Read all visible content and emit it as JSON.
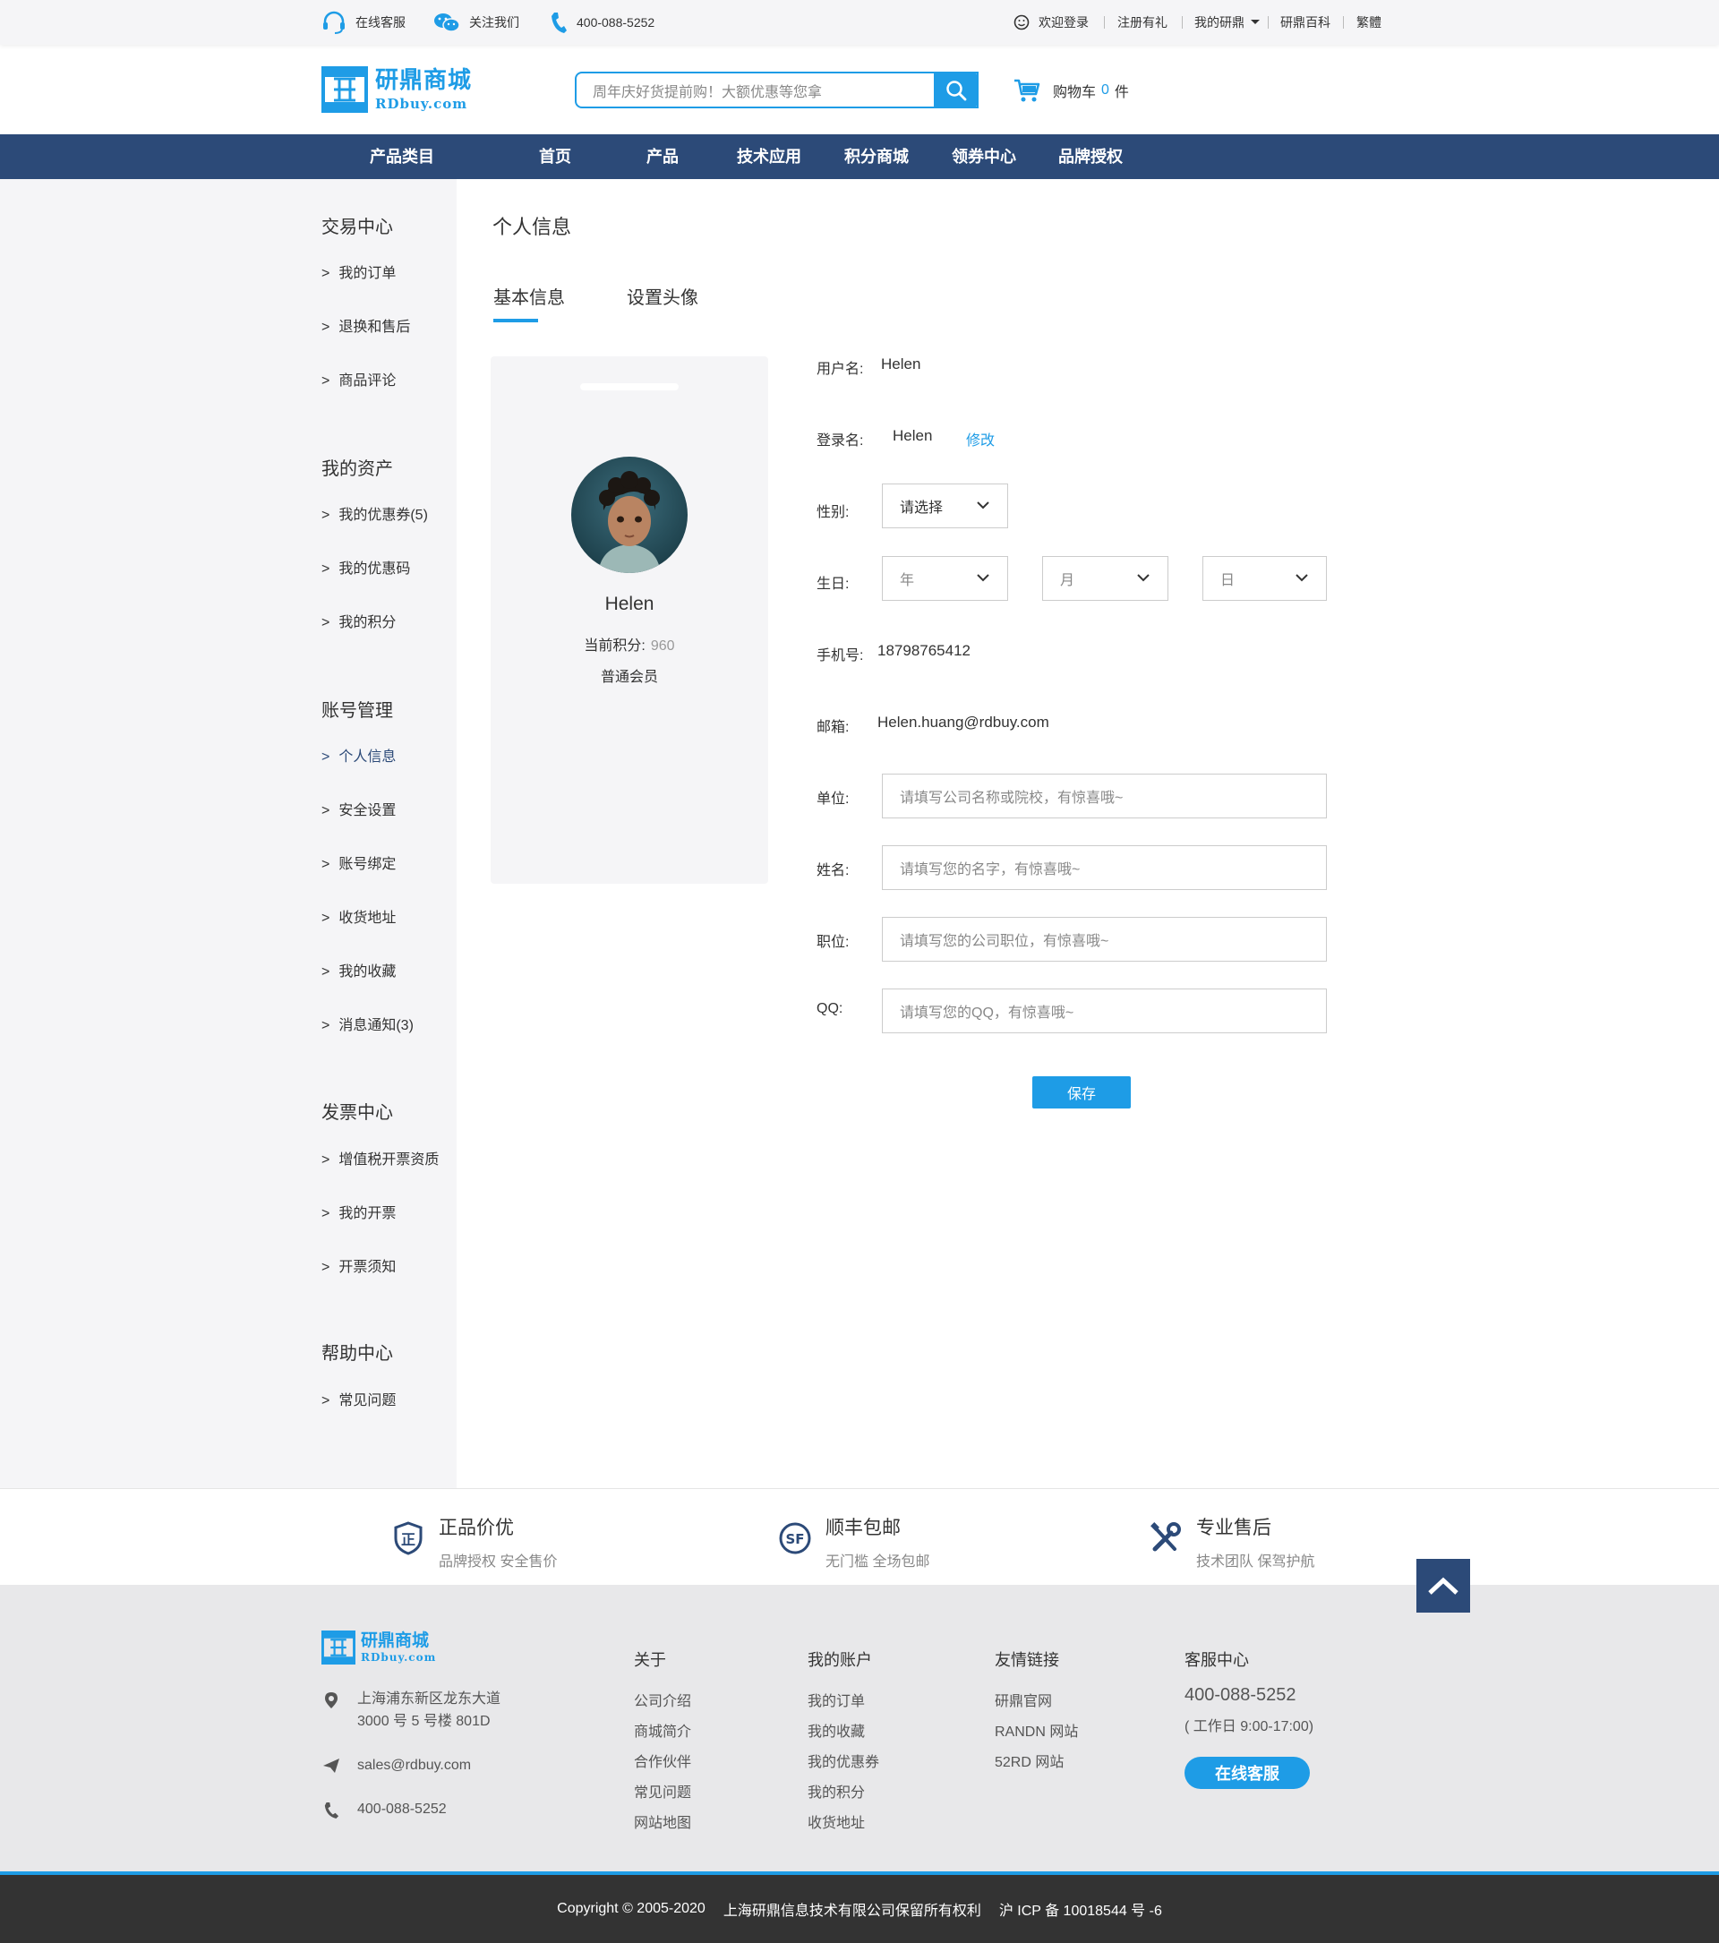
{
  "topbar": {
    "online_service": "在线客服",
    "follow_us": "关注我们",
    "phone": "400-088-5252",
    "welcome": "欢迎登录",
    "register": "注册有礼",
    "my_account": "我的研鼎",
    "wiki": "研鼎百科",
    "traditional": "繁體"
  },
  "header": {
    "logo_cn": "研鼎商城",
    "logo_en": "RDbuy.com",
    "search_placeholder": "周年庆好货提前购！大额优惠等您拿",
    "cart_label": "购物车",
    "cart_count": "0",
    "cart_unit": "件"
  },
  "nav": {
    "items": [
      "产品类目",
      "首页",
      "产品",
      "技术应用",
      "积分商城",
      "领券中心",
      "品牌授权"
    ]
  },
  "sidebar": {
    "sections": [
      {
        "title": "交易中心",
        "items": [
          "我的订单",
          "退换和售后",
          "商品评论"
        ]
      },
      {
        "title": "我的资产",
        "items": [
          "我的优惠券(5)",
          "我的优惠码",
          "我的积分"
        ]
      },
      {
        "title": "账号管理",
        "items": [
          "个人信息",
          "安全设置",
          "账号绑定",
          "收货地址",
          "我的收藏",
          "消息通知(3)"
        ]
      },
      {
        "title": "发票中心",
        "items": [
          "增值税开票资质",
          "我的开票",
          "开票须知"
        ]
      },
      {
        "title": "帮助中心",
        "items": [
          "常见问题"
        ]
      }
    ],
    "arrow": ">"
  },
  "main": {
    "title": "个人信息",
    "tabs": [
      "基本信息",
      "设置头像"
    ],
    "profile": {
      "name": "Helen",
      "points_label": "当前积分:",
      "points_value": "960",
      "level": "普通会员"
    },
    "form": {
      "username_label": "用户名:",
      "username_value": "Helen",
      "login_label": "登录名:",
      "login_value": "Helen",
      "edit_link": "修改",
      "gender_label": "性别:",
      "gender_value": "请选择",
      "birthday_label": "生日:",
      "year_ph": "年",
      "month_ph": "月",
      "day_ph": "日",
      "phone_label": "手机号:",
      "phone_value": "18798765412",
      "email_label": "邮箱:",
      "email_value": "Helen.huang@rdbuy.com",
      "company_label": "单位:",
      "company_ph": "请填写公司名称或院校，有惊喜哦~",
      "name_label": "姓名:",
      "name_ph": "请填写您的名字，有惊喜哦~",
      "position_label": "职位:",
      "position_ph": "请填写您的公司职位，有惊喜哦~",
      "qq_label": "QQ:",
      "qq_ph": "请填写您的QQ，有惊喜哦~",
      "save": "保存"
    }
  },
  "services": [
    {
      "title": "正品价优",
      "sub": "品牌授权  安全售价"
    },
    {
      "title": "顺丰包邮",
      "sub": "无门槛  全场包邮"
    },
    {
      "title": "专业售后",
      "sub": "技术团队  保驾护航"
    }
  ],
  "footer": {
    "logo_cn": "研鼎商城",
    "logo_en": "RDbuy.com",
    "address_line1": "上海浦东新区龙东大道",
    "address_line2": "3000 号 5 号楼 801D",
    "email": "sales@rdbuy.com",
    "phone": "400-088-5252",
    "columns": [
      {
        "title": "关于",
        "items": [
          "公司介绍",
          "商城简介",
          "合作伙伴",
          "常见问题",
          "网站地图"
        ]
      },
      {
        "title": "我的账户",
        "items": [
          "我的订单",
          "我的收藏",
          "我的优惠券",
          "我的积分",
          "收货地址"
        ]
      },
      {
        "title": "友情链接",
        "items": [
          "研鼎官网",
          "RANDN 网站",
          "52RD 网站"
        ]
      }
    ],
    "cs_title": "客服中心",
    "cs_phone": "400-088-5252",
    "cs_hours": "( 工作日 9:00-17:00)",
    "cs_button": "在线客服",
    "copyright": "Copyright © 2005-2020",
    "company": "上海研鼎信息技术有限公司保留所有权利",
    "icp": "沪 ICP 备 10018544 号 -6"
  },
  "colors": {
    "accent": "#1e9ce6",
    "nav_bg": "#2c4a78",
    "sidebar_bg": "#f5f5f7",
    "footer_bg": "#e8e8ea",
    "copyright_bg": "#333333"
  }
}
